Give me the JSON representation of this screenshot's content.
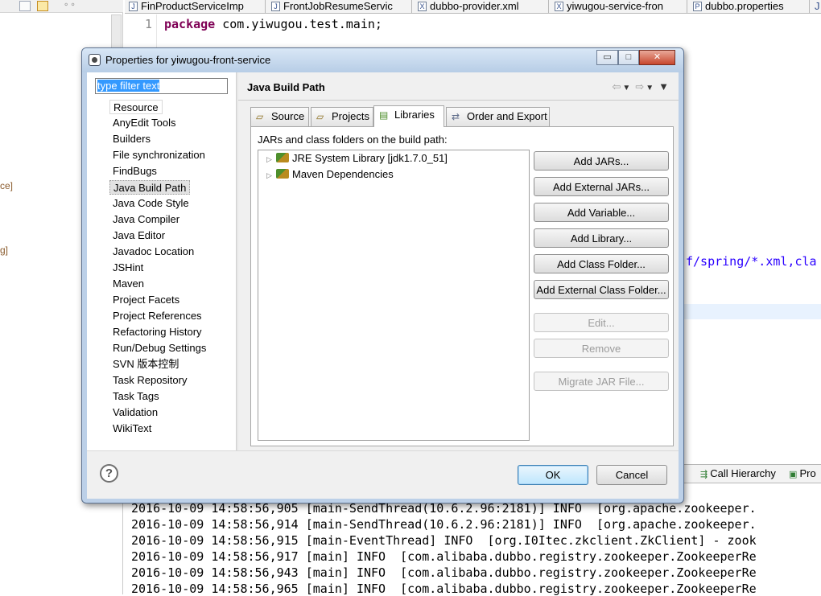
{
  "ide": {
    "editor_tabs": [
      {
        "label": "FinProductServiceImp",
        "icon": "J"
      },
      {
        "label": "FrontJobResumeServic",
        "icon": "J"
      },
      {
        "label": "dubbo-provider.xml",
        "icon": "X"
      },
      {
        "label": "yiwugou-service-fron",
        "icon": "X"
      },
      {
        "label": "dubbo.properties",
        "icon": "P"
      },
      {
        "label": "J",
        "icon": ""
      }
    ],
    "line_number": "1",
    "code_keyword": "package",
    "code_rest": " com.yiwugou.test.main;",
    "code_fragment": "f/spring/*.xml,cla",
    "left_fragments": [
      "ce]",
      "g]"
    ],
    "bottom_tabs": [
      "Call Hierarchy",
      "Pro"
    ],
    "console_lines": [
      "2016-10-09 14:58:56,905 [main-SendThread(10.6.2.96:2181)] INFO  [org.apache.zookeeper.",
      "2016-10-09 14:58:56,914 [main-SendThread(10.6.2.96:2181)] INFO  [org.apache.zookeeper.",
      "2016-10-09 14:58:56,915 [main-EventThread] INFO  [org.I0Itec.zkclient.ZkClient] - zook",
      "2016-10-09 14:58:56,917 [main] INFO  [com.alibaba.dubbo.registry.zookeeper.ZookeeperRe",
      "2016-10-09 14:58:56,943 [main] INFO  [com.alibaba.dubbo.registry.zookeeper.ZookeeperRe",
      "2016-10-09 14:58:56,965 [main] INFO  [com.alibaba.dubbo.registry.zookeeper.ZookeeperRe"
    ]
  },
  "dialog": {
    "title": "Properties for yiwugou-front-service",
    "filter_value": "type filter text",
    "nav_items": [
      "Resource",
      "AnyEdit Tools",
      "Builders",
      "File synchronization",
      "FindBugs",
      "Java Build Path",
      "Java Code Style",
      "Java Compiler",
      "Java Editor",
      "Javadoc Location",
      "JSHint",
      "Maven",
      "Project Facets",
      "Project References",
      "Refactoring History",
      "Run/Debug Settings",
      "SVN 版本控制",
      "Task Repository",
      "Task Tags",
      "Validation",
      "WikiText"
    ],
    "selected_nav": "Java Build Path",
    "page_title": "Java Build Path",
    "tabs": [
      {
        "label": "Source",
        "icon": "folder-icon"
      },
      {
        "label": "Projects",
        "icon": "projects-icon"
      },
      {
        "label": "Libraries",
        "icon": "libraries-icon"
      },
      {
        "label": "Order and Export",
        "icon": "order-icon"
      }
    ],
    "active_tab": "Libraries",
    "panel_label": "JARs and class folders on the build path:",
    "tree_items": [
      "JRE System Library [jdk1.7.0_51]",
      "Maven Dependencies"
    ],
    "buttons": {
      "add_jars": "Add JARs...",
      "add_external_jars": "Add External JARs...",
      "add_variable": "Add Variable...",
      "add_library": "Add Library...",
      "add_class_folder": "Add Class Folder...",
      "add_external_class_folder": "Add External Class Folder...",
      "edit": "Edit...",
      "remove": "Remove",
      "migrate_jar": "Migrate JAR File..."
    },
    "ok": "OK",
    "cancel": "Cancel",
    "help": "?",
    "window_controls": {
      "minimize": "▭",
      "maximize": "□",
      "close": "✕"
    }
  }
}
